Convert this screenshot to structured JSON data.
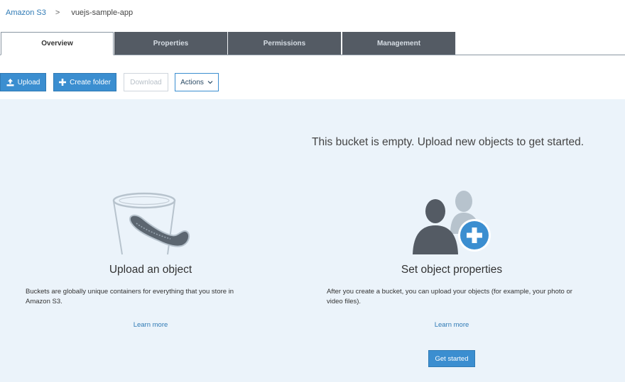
{
  "breadcrumb": {
    "root": "Amazon S3",
    "separator": ">",
    "current": "vuejs-sample-app"
  },
  "tabs": [
    {
      "label": "Overview",
      "active": true
    },
    {
      "label": "Properties",
      "active": false
    },
    {
      "label": "Permissions",
      "active": false
    },
    {
      "label": "Management",
      "active": false
    }
  ],
  "toolbar": {
    "upload_label": "Upload",
    "create_folder_label": "Create folder",
    "download_label": "Download",
    "actions_label": "Actions"
  },
  "main": {
    "empty_message": "This bucket is empty. Upload new objects to get started.",
    "upload_card": {
      "title": "Upload an object",
      "description": "Buckets are globally unique containers for everything that you store in Amazon S3.",
      "link": "Learn more",
      "icon": "bucket-icon"
    },
    "properties_card": {
      "title": "Set object properties",
      "description": "After you create a bucket, you can upload your objects (for example, your photo or video files).",
      "link": "Learn more",
      "button": "Get started",
      "icon": "add-user-icon"
    }
  },
  "colors": {
    "accent": "#3b8ed0",
    "link": "#2f7ab5",
    "tab_inactive": "#545b64",
    "panel_bg": "#ebf3fa"
  }
}
